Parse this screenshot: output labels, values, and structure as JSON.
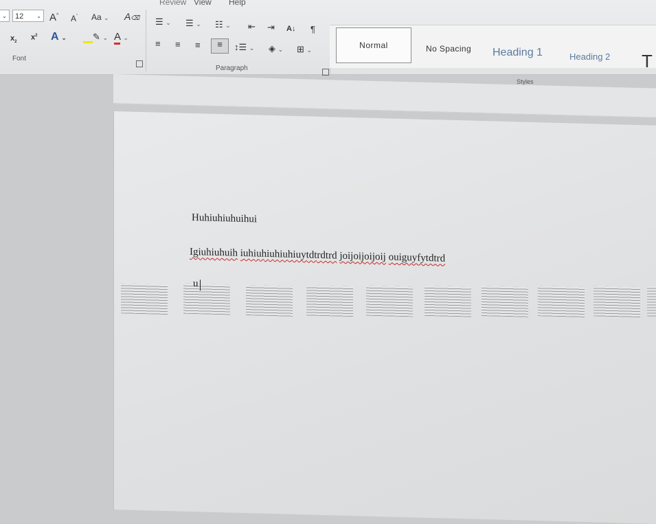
{
  "menu": {
    "view": "View",
    "help": "Help",
    "review": "Review"
  },
  "font": {
    "size": "12",
    "grow_label": "A",
    "shrink_label": "A",
    "case_label": "Aa",
    "group_label": "Font"
  },
  "paragraph": {
    "group_label": "Paragraph",
    "sort_label": "A↓",
    "pilcrow": "¶"
  },
  "styles": {
    "group_label": "Styles",
    "items": [
      "Normal",
      "No Spacing",
      "Heading 1",
      "Heading 2"
    ]
  },
  "document": {
    "line1": "Huhiuhiuhuihui",
    "line2_words": [
      "Igiuhiuhuih",
      "iuhiuhiuhiuhiuytdtrdtrd",
      "joijoijoijoij",
      "ouiguyfytdtrd"
    ],
    "cursor_text": "u"
  },
  "colors": {
    "highlight": "#f2e600",
    "font_color": "#d32f2f",
    "accent": "#2b579a"
  }
}
